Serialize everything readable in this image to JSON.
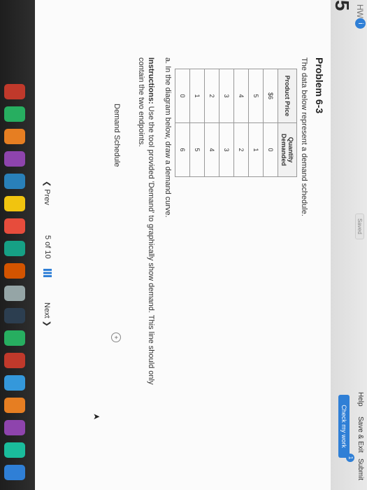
{
  "header": {
    "hw_label": "HW",
    "info_badge": "i",
    "saved_label": "Saved",
    "help_label": "Help",
    "save_exit_label": "Save & Exit",
    "submit_label": "Submit",
    "check_button_label": "Check my work",
    "check_badge": "1",
    "problem_index": "5"
  },
  "problem": {
    "title": "Problem 6-3",
    "intro": "The data below represent a demand schedule.",
    "table": {
      "headers": [
        "Product Price",
        "Quantity Demanded"
      ],
      "rows": [
        [
          "$6",
          "0"
        ],
        [
          "5",
          "1"
        ],
        [
          "4",
          "2"
        ],
        [
          "3",
          "3"
        ],
        [
          "2",
          "4"
        ],
        [
          "1",
          "5"
        ],
        [
          "0",
          "6"
        ]
      ]
    },
    "part_a": "a. In the diagram below, draw a demand curve.",
    "instructions_label": "Instructions:",
    "instructions_text": " Use the tool provided 'Demand' to graphically show demand. This line should only contain the two endpoints.",
    "schedule_label": "Demand Schedule",
    "plus_symbol": "+"
  },
  "nav": {
    "prev_label": "❮  Prev",
    "page_indicator": "5 of 10",
    "next_label": "Next  ❯"
  },
  "colors": {
    "accent": "#2f7fd6"
  }
}
